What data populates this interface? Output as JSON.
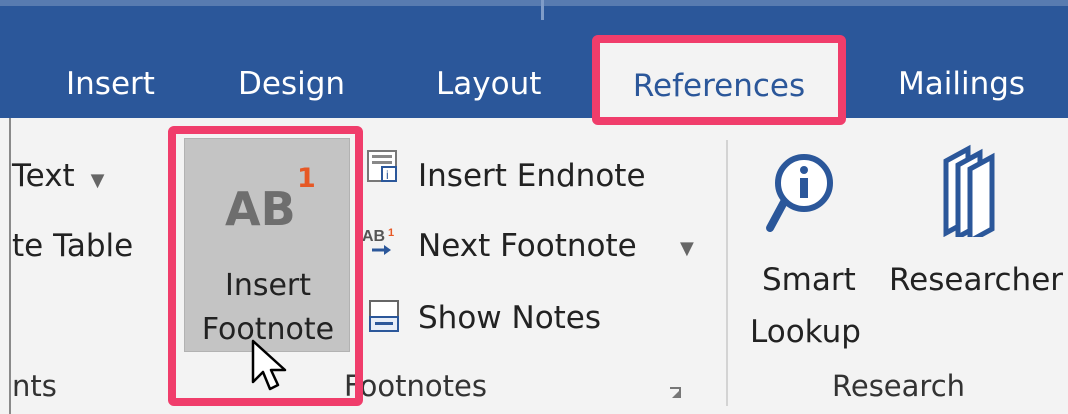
{
  "tabs": {
    "insert": "Insert",
    "design": "Design",
    "layout": "Layout",
    "references": "References",
    "mailings": "Mailings"
  },
  "left_partial": {
    "text_item": "Text",
    "table_item": "te Table",
    "group_label": "nts"
  },
  "footnotes_group": {
    "insert_footnote_line1": "Insert",
    "insert_footnote_line2": "Footnote",
    "insert_endnote": "Insert Endnote",
    "next_footnote": "Next Footnote",
    "show_notes": "Show Notes",
    "group_label": "Footnotes",
    "icon_text_ab": "AB",
    "icon_sup_one": "1"
  },
  "research_group": {
    "smart_lookup_line1": "Smart",
    "smart_lookup_line2": "Lookup",
    "researcher": "Researcher",
    "group_label": "Research"
  },
  "icons": {
    "insert_endnote": "insert-endnote-icon",
    "next_footnote": "next-footnote-icon",
    "show_notes": "show-notes-icon",
    "smart_lookup": "smart-lookup-icon",
    "researcher": "researcher-icon",
    "insert_footnote": "insert-footnote-icon",
    "cursor": "mouse-pointer-icon"
  },
  "colors": {
    "ribbon_blue": "#2b579a",
    "highlight": "#f03d6b",
    "footnote_accent": "#e65825"
  }
}
